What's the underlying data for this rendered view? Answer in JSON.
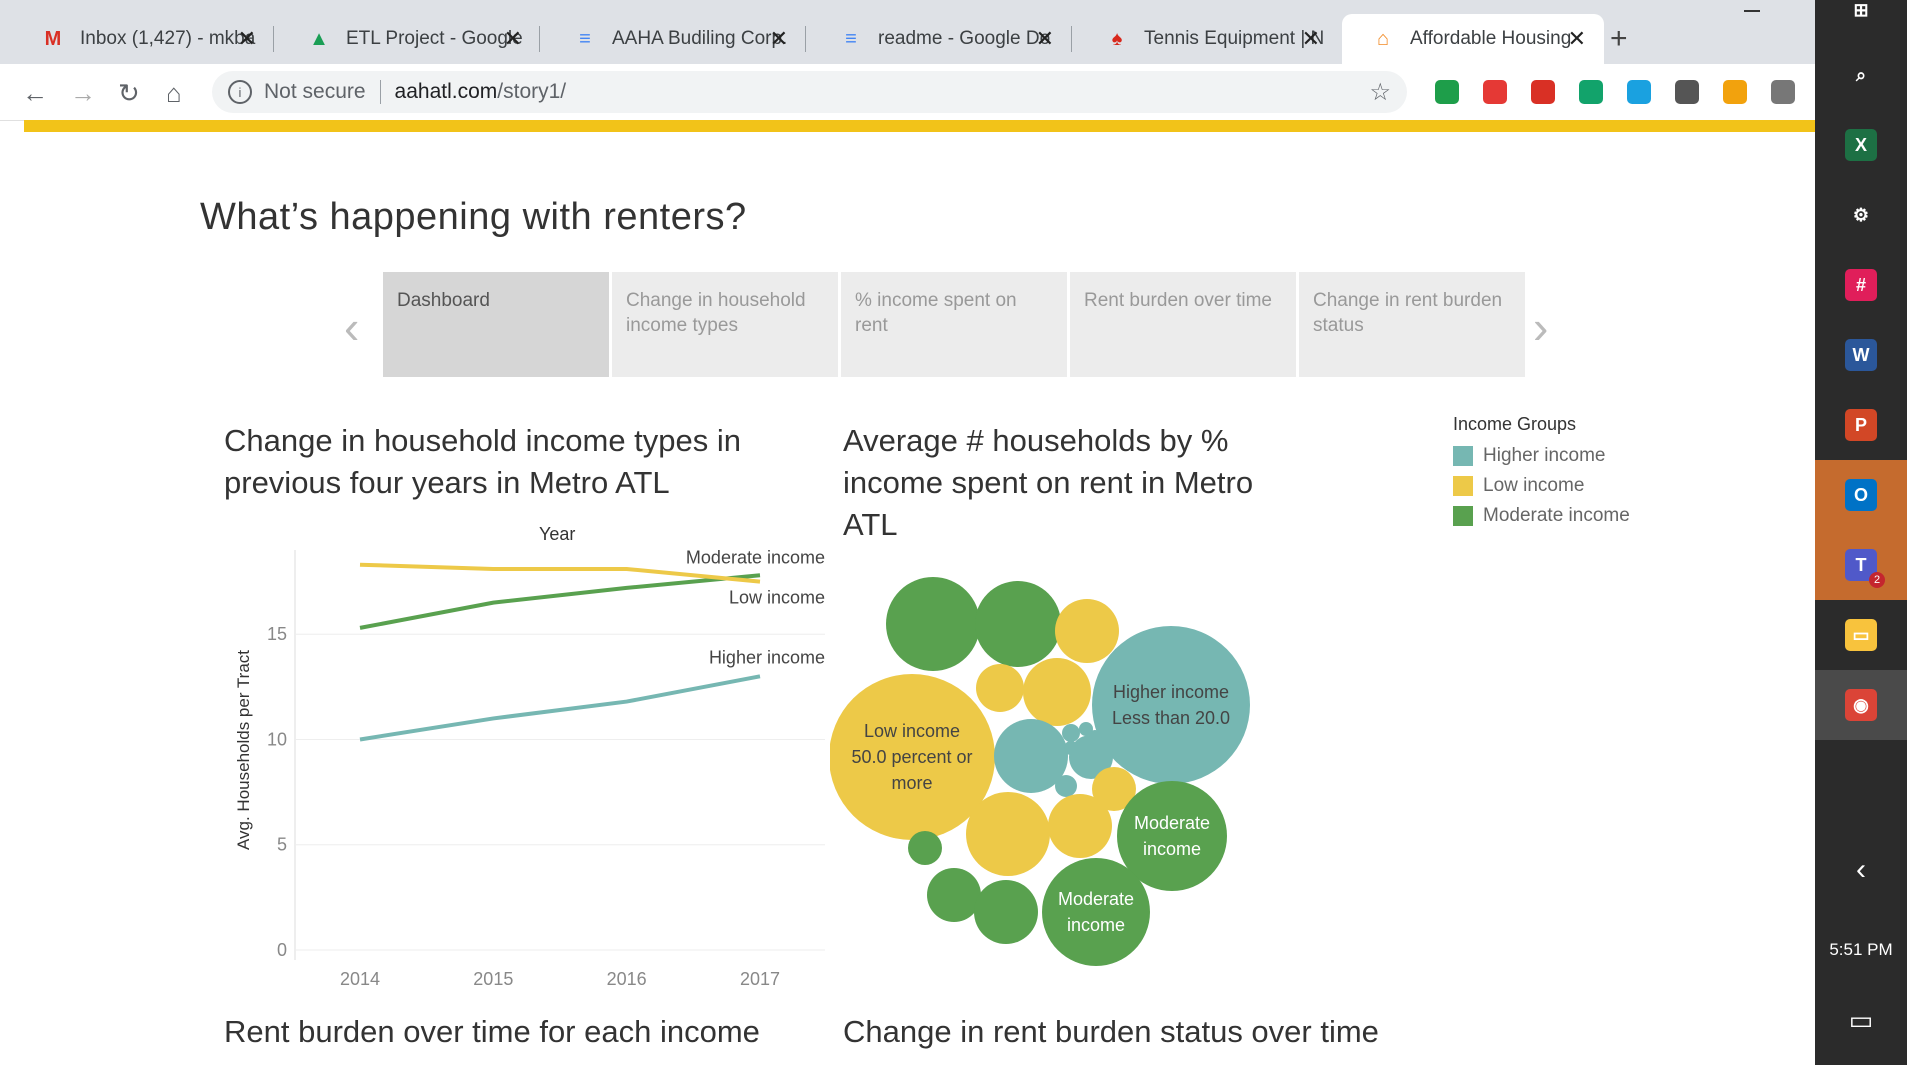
{
  "browser": {
    "tabs": [
      {
        "label": "Inbox (1,427) - mkba",
        "icon": "gmail-icon",
        "color": "#d93025",
        "glyph": "M"
      },
      {
        "label": "ETL Project - Google",
        "icon": "google-drive-icon",
        "color": "#1a9e55",
        "glyph": "▲"
      },
      {
        "label": "AAHA Budiling Corp.",
        "icon": "google-docs-icon",
        "color": "#4285f4",
        "glyph": "≡"
      },
      {
        "label": "readme - Google Do",
        "icon": "google-docs-icon",
        "color": "#4285f4",
        "glyph": "≡"
      },
      {
        "label": "Tennis Equipment | N",
        "icon": "tennis-site-icon",
        "color": "#d8281c",
        "glyph": "♠"
      },
      {
        "label": "Affordable Housing",
        "icon": "housing-site-icon",
        "color": "#f28c28",
        "glyph": "⌂"
      }
    ],
    "active_tab_index": 5,
    "address": {
      "security": "Not secure",
      "host": "aahatl.com",
      "path": "/story1/"
    },
    "extensions": [
      "#1e9e4a",
      "#e53935",
      "#d93025",
      "#12a36b",
      "#1aa1e0",
      "#555555",
      "#f2a20d",
      "#777777"
    ]
  },
  "page": {
    "title": "What’s happening with renters?",
    "story_points": [
      {
        "label": "Dashboard",
        "active": true
      },
      {
        "label": "Change in household income types",
        "active": false
      },
      {
        "label": "% income spent on rent",
        "active": false
      },
      {
        "label": "Rent burden over time",
        "active": false
      },
      {
        "label": "Change in rent burden status",
        "active": false
      }
    ],
    "sheets": {
      "line_title": "Change in household income types in previous four years in Metro ATL",
      "bubble_title": "Average # households by % income spent on rent in Metro ATL",
      "bottom_left_title": "Rent burden over time for each income",
      "bottom_right_title": "Change in rent burden status over time"
    },
    "legend": {
      "title": "Income Groups",
      "items": [
        {
          "label": "Higher income",
          "color": "#76b7b2"
        },
        {
          "label": "Low income",
          "color": "#edc948"
        },
        {
          "label": "Moderate income",
          "color": "#59a14f"
        }
      ]
    }
  },
  "chart_data": [
    {
      "type": "line",
      "title": "Change in household income types in previous four years in Metro ATL",
      "xlabel": "Year",
      "ylabel": "Avg. Households per Tract",
      "x": [
        2014,
        2015,
        2016,
        2017
      ],
      "ylim": [
        0,
        19
      ],
      "yticks": [
        0,
        5,
        10,
        15
      ],
      "grid": true,
      "series": [
        {
          "name": "Moderate income",
          "color": "#59a14f",
          "values": [
            15.3,
            16.5,
            17.2,
            17.8
          ]
        },
        {
          "name": "Low income",
          "color": "#edc948",
          "values": [
            18.3,
            18.1,
            18.1,
            17.5
          ]
        },
        {
          "name": "Higher income",
          "color": "#76b7b2",
          "values": [
            10.0,
            11.0,
            11.8,
            13.0
          ]
        }
      ]
    },
    {
      "type": "bubble",
      "title": "Average # households by % income spent on rent in Metro ATL",
      "labeled_bubbles": [
        {
          "group": "Low income",
          "label": "Low income\n50.0 percent or more"
        },
        {
          "group": "Higher income",
          "label": "Higher income\nLess than 20.0"
        },
        {
          "group": "Moderate income",
          "label": "Moderate\nincome"
        },
        {
          "group": "Moderate income",
          "label": "Moderate\nincome"
        }
      ]
    }
  ],
  "taskbar": {
    "clock": "5:51 PM",
    "apps": [
      {
        "name": "windows-start-icon",
        "color": "#ffffff",
        "glyph": "⊞"
      },
      {
        "name": "search-icon",
        "color": "#ffffff",
        "glyph": "⌕"
      },
      {
        "name": "excel-icon",
        "color": "#1d7044",
        "glyph": "X"
      },
      {
        "name": "settings-icon",
        "color": "#ffffff",
        "glyph": "⚙"
      },
      {
        "name": "slack-icon",
        "color": "#e01e5a",
        "glyph": "#"
      },
      {
        "name": "word-icon",
        "color": "#2b579a",
        "glyph": "W"
      },
      {
        "name": "powerpoint-icon",
        "color": "#d24726",
        "glyph": "P"
      },
      {
        "name": "outlook-icon",
        "color": "#0072c6",
        "glyph": "O"
      },
      {
        "name": "teams-icon",
        "color": "#5059c9",
        "glyph": "T",
        "badge": "2"
      },
      {
        "name": "file-explorer-icon",
        "color": "#f8c33d",
        "glyph": "▭"
      },
      {
        "name": "chrome-icon",
        "color": "#db4437",
        "glyph": "◉"
      }
    ]
  }
}
